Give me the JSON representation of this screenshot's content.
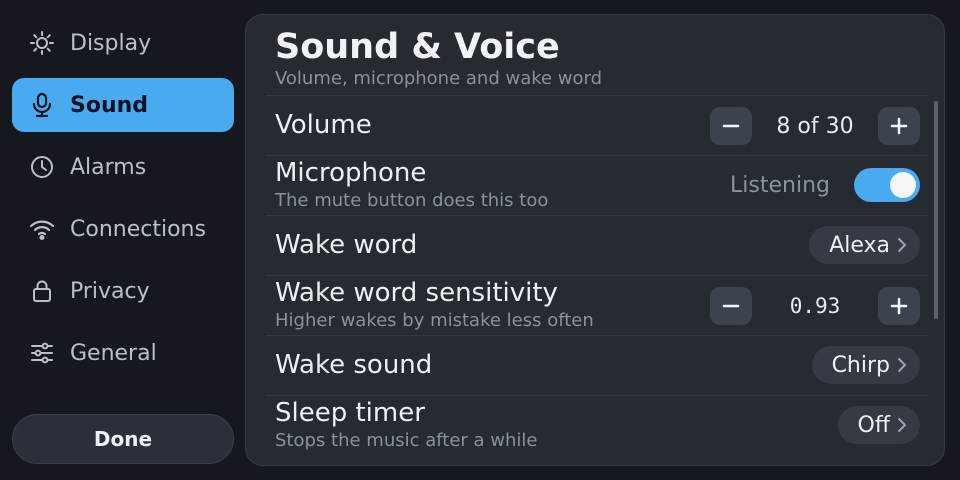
{
  "sidebar": {
    "items": [
      {
        "label": "Display",
        "icon": "sun-icon",
        "active": false
      },
      {
        "label": "Sound",
        "icon": "microphone-icon",
        "active": true
      },
      {
        "label": "Alarms",
        "icon": "clock-icon",
        "active": false
      },
      {
        "label": "Connections",
        "icon": "wifi-icon",
        "active": false
      },
      {
        "label": "Privacy",
        "icon": "lock-icon",
        "active": false
      },
      {
        "label": "General",
        "icon": "sliders-icon",
        "active": false
      }
    ],
    "done_label": "Done"
  },
  "panel": {
    "title": "Sound & Voice",
    "subtitle": "Volume, microphone and wake word",
    "volume": {
      "label": "Volume",
      "value_text": "8 of 30",
      "value": 8,
      "max": 30
    },
    "microphone": {
      "label": "Microphone",
      "sub": "The mute button does this too",
      "state": "Listening",
      "on": true
    },
    "wake_word": {
      "label": "Wake word",
      "value": "Alexa"
    },
    "sensitivity": {
      "label": "Wake word sensitivity",
      "sub": "Higher wakes by mistake less often",
      "value": "0.93"
    },
    "wake_sound": {
      "label": "Wake sound",
      "value": "Chirp"
    },
    "sleep_timer": {
      "label": "Sleep timer",
      "sub": "Stops the music after a while",
      "value": "Off"
    }
  },
  "colors": {
    "accent": "#4aaaf0",
    "background": "#15191f",
    "panel": "#262a31"
  }
}
